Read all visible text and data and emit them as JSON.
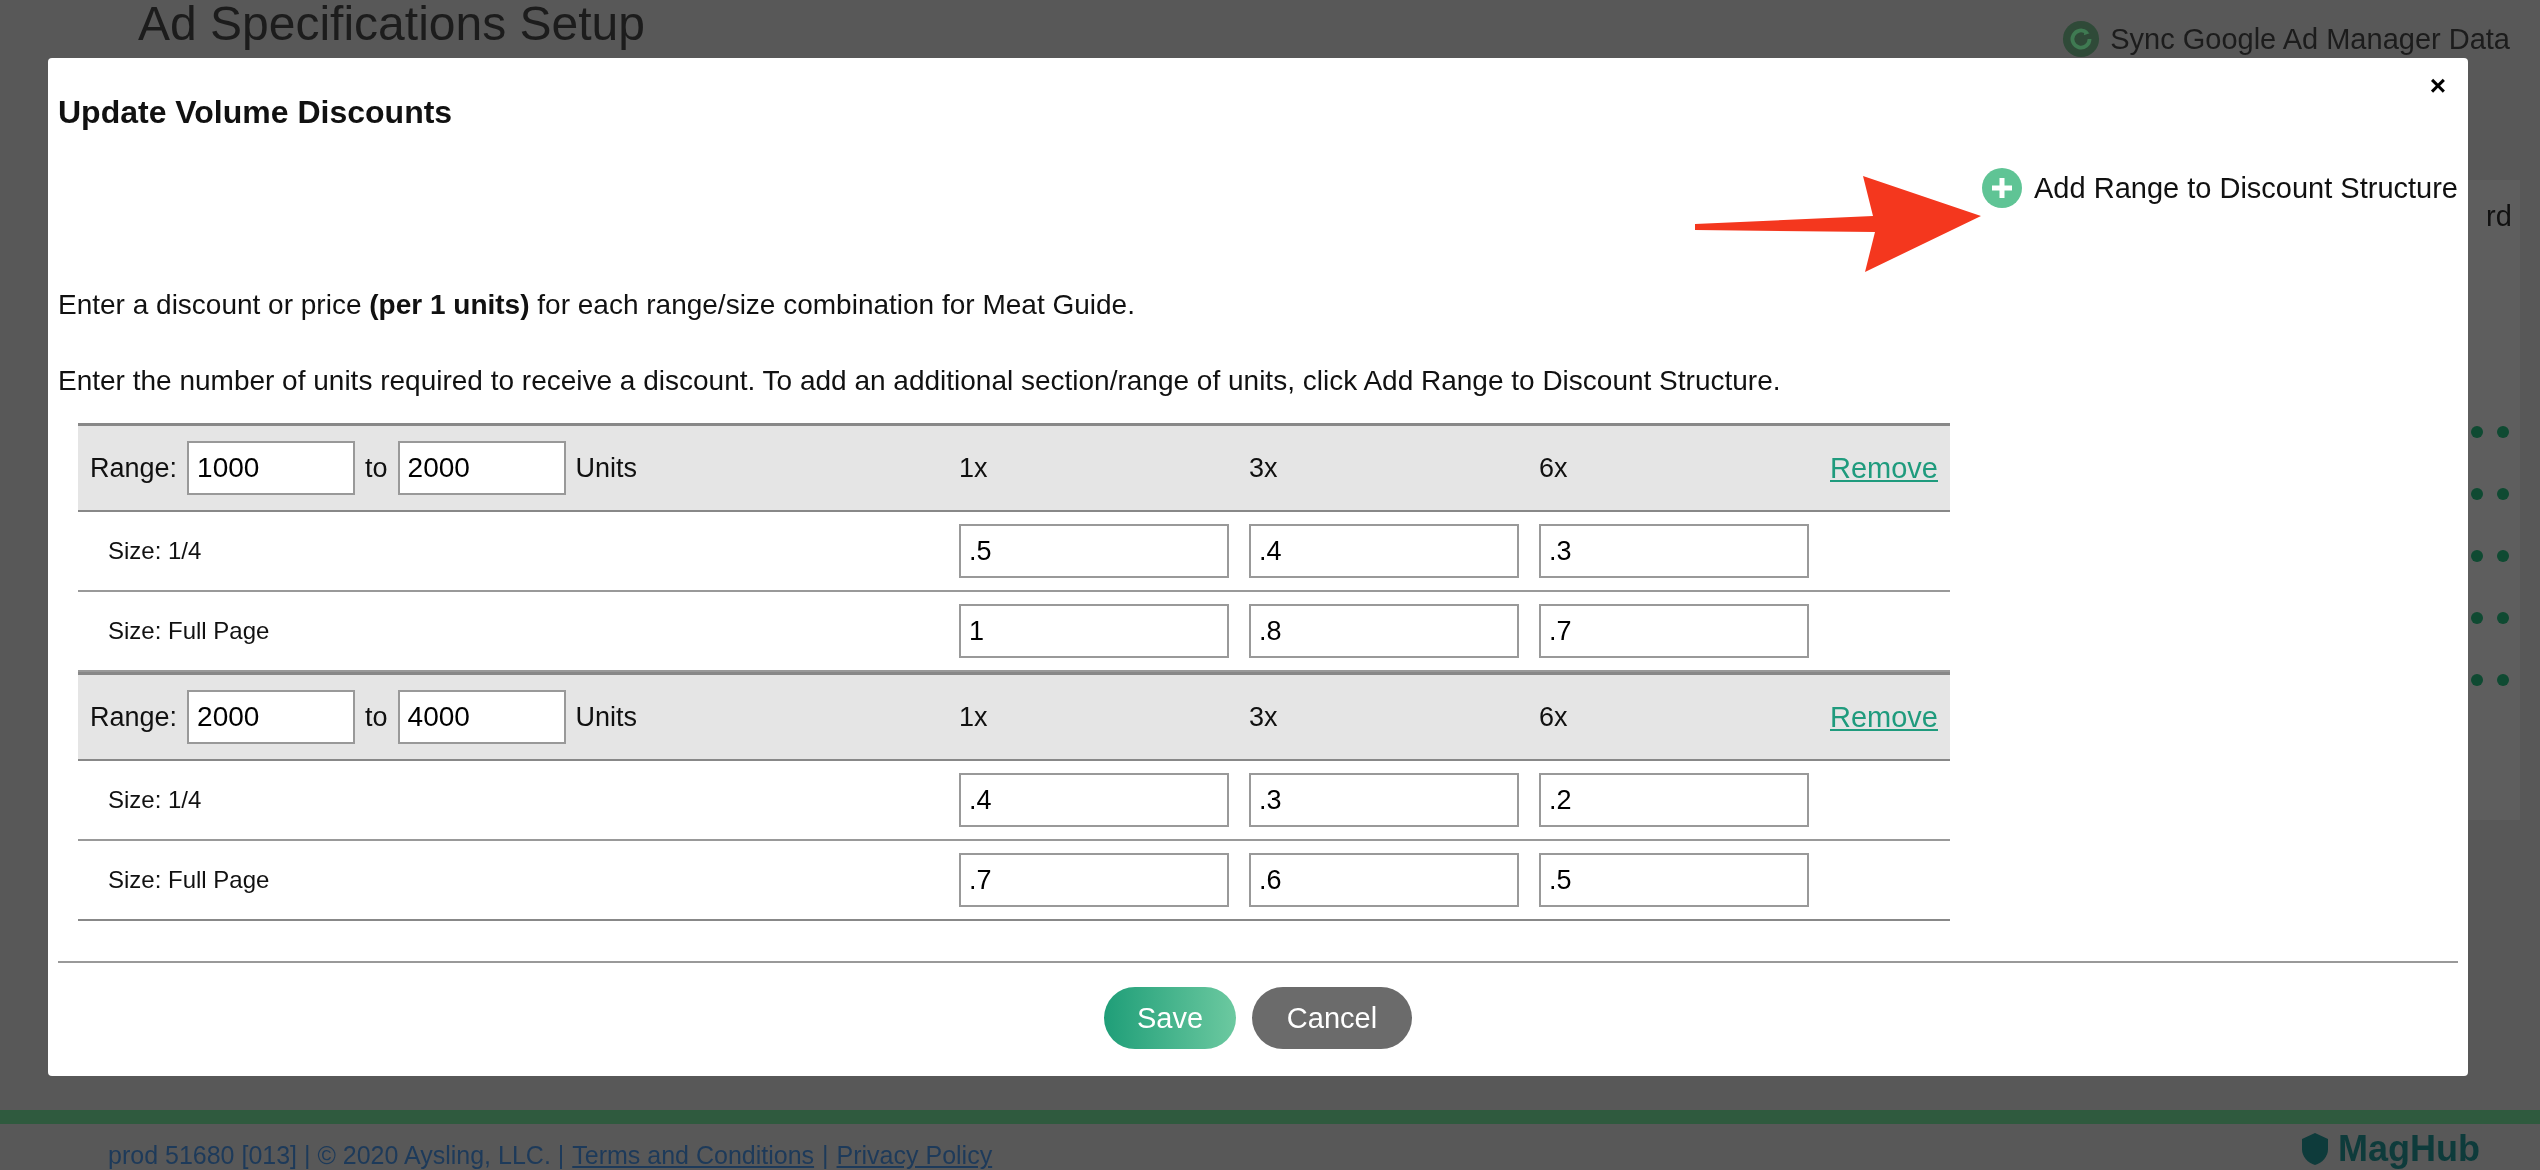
{
  "page": {
    "title": "Ad Specifications Setup",
    "sync_link": "Sync Google Ad Manager Data",
    "side_fragment": "rd"
  },
  "modal": {
    "title": "Update Volume Discounts",
    "close": "×",
    "add_range": "Add Range to Discount Structure",
    "instructions": [
      "Enter a discount or price **(per 1 units)** for each range/size combination for Meat Guide.",
      "Enter the number of units required to receive a discount. To add an additional section/range of units, click Add Range to Discount Structure."
    ],
    "ranges": [
      {
        "label": "Range:",
        "from": "1000",
        "to_label": "to",
        "to": "2000",
        "units": "Units",
        "columns": [
          "1x",
          "3x",
          "6x"
        ],
        "remove": "Remove",
        "sizes": [
          {
            "label": "Size: 1/4",
            "values": [
              ".5",
              ".4",
              ".3"
            ]
          },
          {
            "label": "Size: Full Page",
            "values": [
              "1",
              ".8",
              ".7"
            ]
          }
        ]
      },
      {
        "label": "Range:",
        "from": "2000",
        "to_label": "to",
        "to": "4000",
        "units": "Units",
        "columns": [
          "1x",
          "3x",
          "6x"
        ],
        "remove": "Remove",
        "sizes": [
          {
            "label": "Size: 1/4",
            "values": [
              ".4",
              ".3",
              ".2"
            ]
          },
          {
            "label": "Size: Full Page",
            "values": [
              ".7",
              ".6",
              ".5"
            ]
          }
        ]
      }
    ],
    "buttons": [
      {
        "label": "Save",
        "kind": "primary"
      },
      {
        "label": "Cancel",
        "kind": "secondary"
      }
    ]
  },
  "footer": {
    "parts": [
      {
        "kind": "text",
        "text": "prod 51680 [013] | © 2020 Aysling, LLC. |"
      },
      {
        "kind": "link",
        "text": "Terms and Conditions"
      },
      {
        "kind": "text",
        "text": "|"
      },
      {
        "kind": "link",
        "text": "Privacy Policy"
      }
    ],
    "logo": "MagHub"
  }
}
